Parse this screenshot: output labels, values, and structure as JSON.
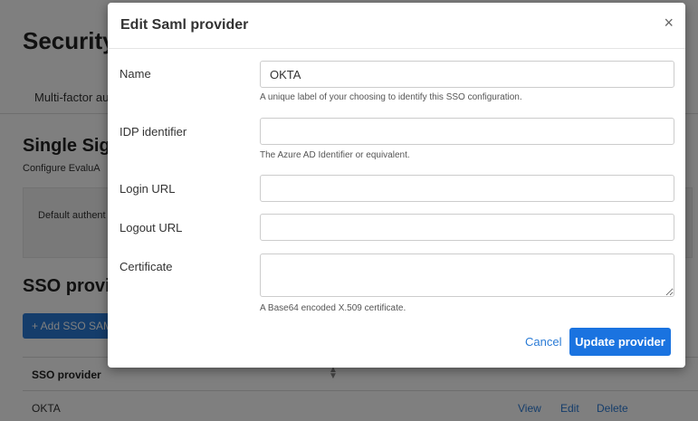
{
  "background": {
    "page_title": "Security",
    "tab_label": "Multi-factor au",
    "section_title": "Single Sign",
    "section_desc": "Configure EvaluA",
    "panel_text": "Default authent",
    "sso_title": "SSO provid",
    "add_button": "+ Add SSO SAM",
    "table": {
      "header_provider": "SSO provider",
      "rows": [
        {
          "provider": "OKTA",
          "view": "View",
          "edit": "Edit",
          "delete": "Delete"
        }
      ]
    }
  },
  "modal": {
    "title": "Edit Saml provider",
    "close_glyph": "×",
    "fields": {
      "name": {
        "label": "Name",
        "value": "OKTA",
        "help": "A unique label of your choosing to identify this SSO configuration."
      },
      "idp": {
        "label": "IDP identifier",
        "value": "",
        "help": "The Azure AD Identifier or equivalent."
      },
      "login_url": {
        "label": "Login URL",
        "value": ""
      },
      "logout_url": {
        "label": "Logout URL",
        "value": ""
      },
      "certificate": {
        "label": "Certificate",
        "value": "",
        "help": "A Base64 encoded X.509 certificate."
      }
    },
    "cancel_label": "Cancel",
    "submit_label": "Update provider"
  },
  "colors": {
    "primary": "#1a73e0",
    "link": "#2a7bd6",
    "overlay": "rgba(0,0,0,0.5)"
  }
}
